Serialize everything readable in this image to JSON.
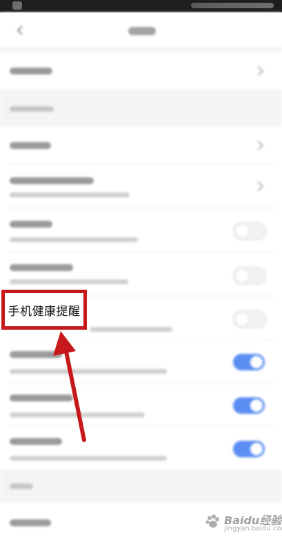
{
  "highlight": {
    "label": "手机健康提醒"
  },
  "watermark": {
    "brand": "Baidu经验",
    "url": "jingyan.baidu.com"
  },
  "icons": {
    "back": "back-arrow-icon",
    "chevron": "chevron-right-icon",
    "paw": "baidu-paw-icon",
    "arrow": "annotation-arrow"
  },
  "toggles": {
    "row_1": false,
    "row_2": false,
    "row_3": false,
    "row_4": true,
    "row_5": true,
    "row_6": true
  },
  "colors": {
    "highlight_border": "#c7191b",
    "toggle_on": "#5a8ef3",
    "annotation_arrow": "#c7191b"
  }
}
